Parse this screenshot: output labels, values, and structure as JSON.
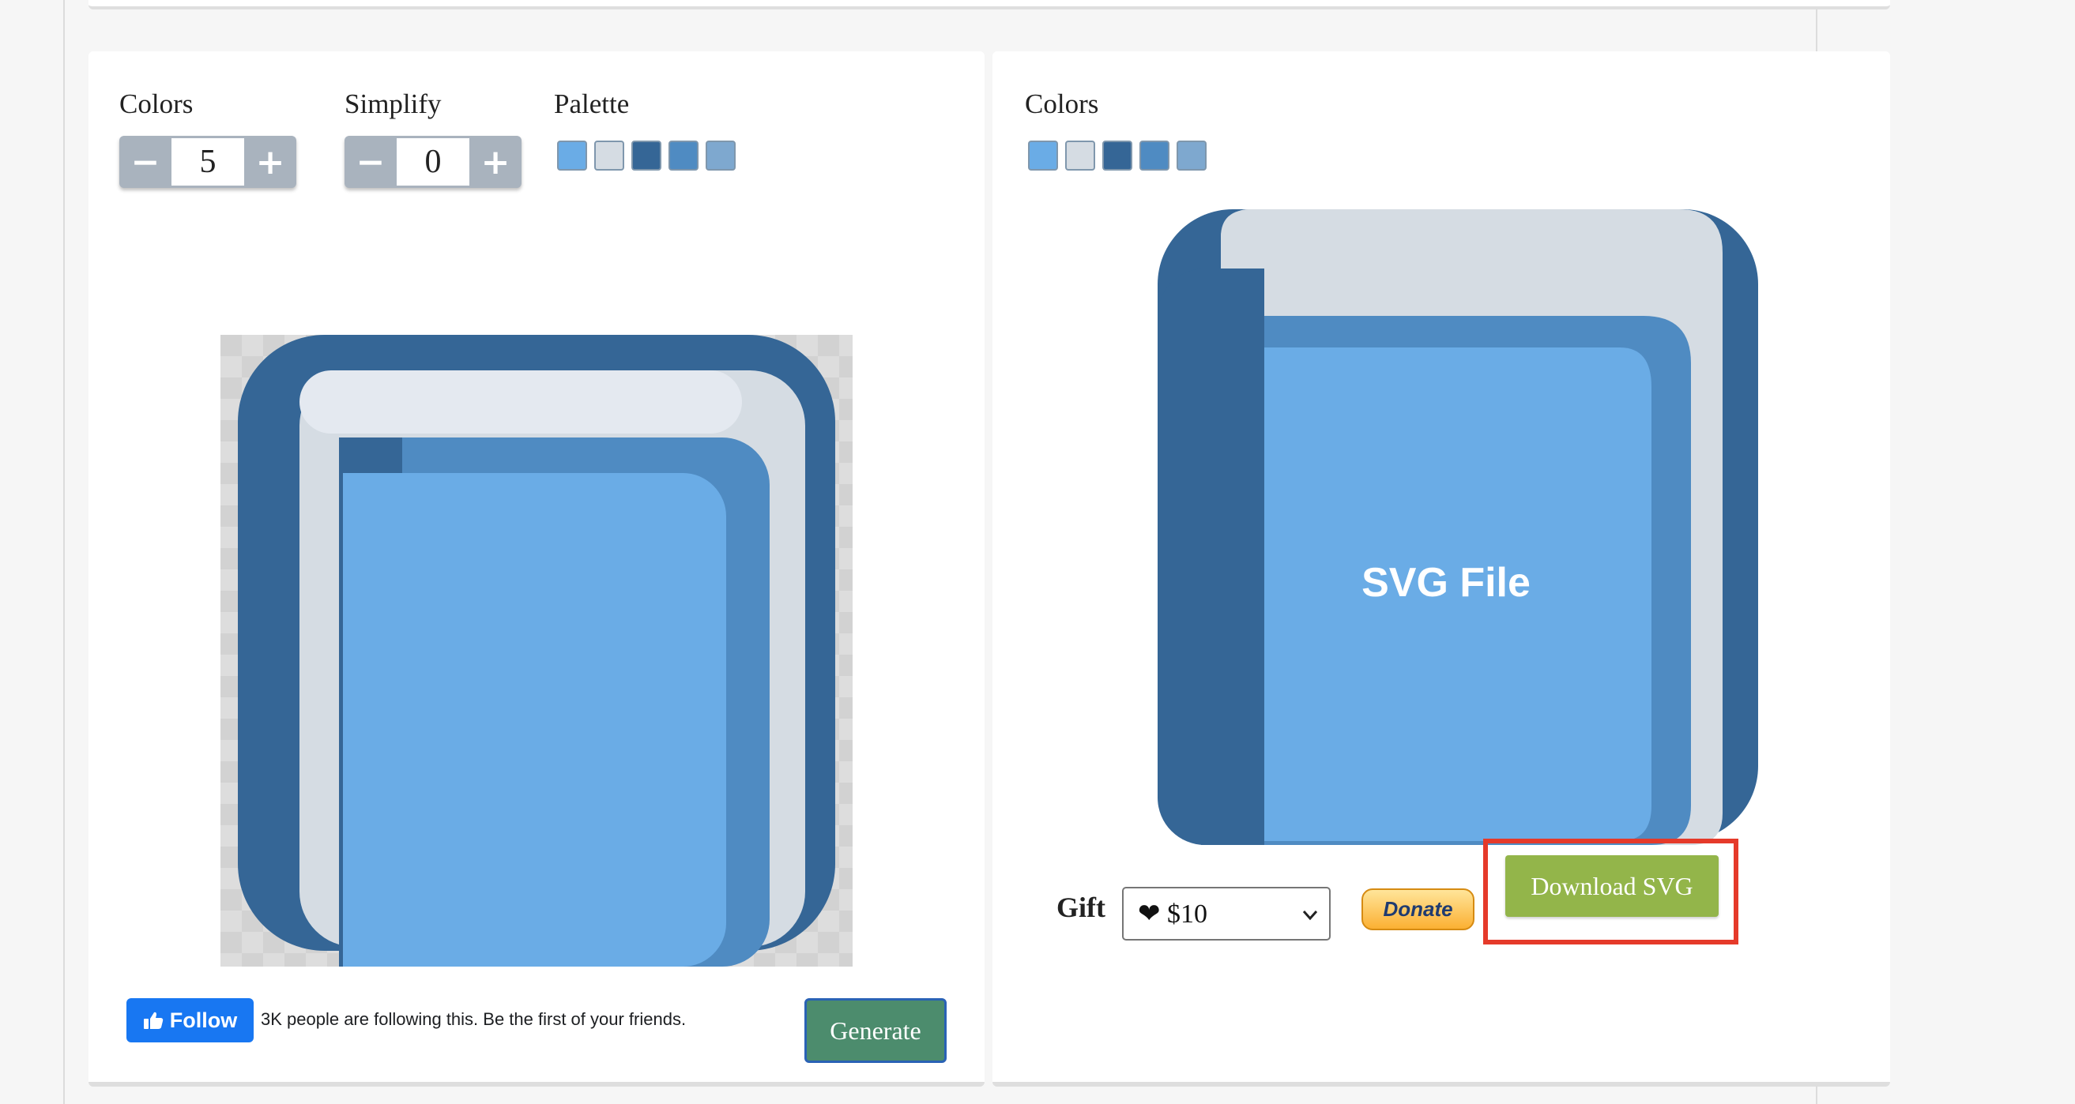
{
  "colors": {
    "accent_border": "#e53a2a",
    "generate_bg": "#4c8c6d",
    "download_bg": "#93b54a",
    "fb_blue": "#1877f2"
  },
  "left_panel": {
    "colors_label": "Colors",
    "colors_value": "5",
    "simplify_label": "Simplify",
    "simplify_value": "0",
    "palette_label": "Palette",
    "palette": [
      "#6aace6",
      "#d5dce3",
      "#356696",
      "#4f8bc2",
      "#7ea8cf"
    ],
    "minus_symbol": "−",
    "plus_symbol": "+",
    "preview_icon": "blue-book-icon"
  },
  "right_panel": {
    "colors_label": "Colors",
    "palette": [
      "#6aace6",
      "#d5dce3",
      "#356696",
      "#4f8bc2",
      "#7ea8cf"
    ],
    "svg_caption": "SVG File",
    "svg_icon": "blue-book-icon"
  },
  "footer": {
    "follow_label": "Follow",
    "follow_text": "3K people are following this. Be the first of your friends.",
    "generate_label": "Generate"
  },
  "gift": {
    "label": "Gift",
    "selected": "❤ $10",
    "donate_label": "Donate"
  },
  "download": {
    "label": "Download SVG"
  }
}
